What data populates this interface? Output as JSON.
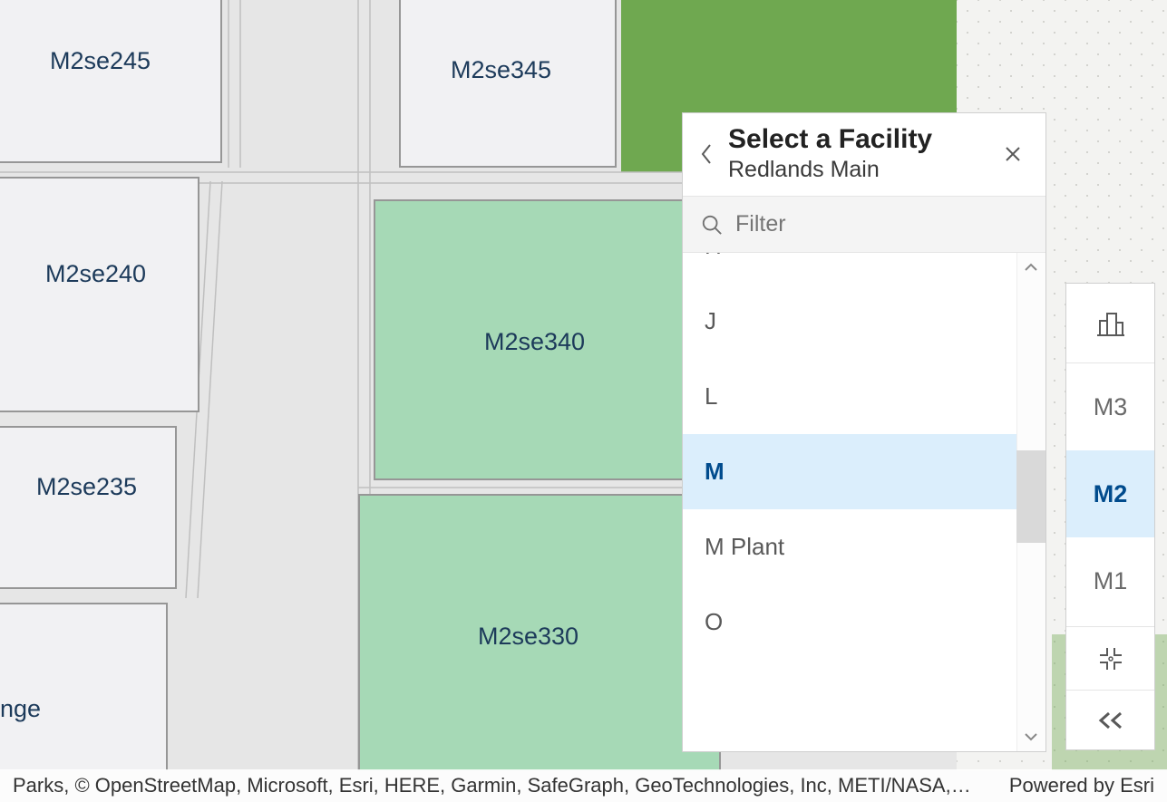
{
  "rooms": {
    "r245": "M2se245",
    "r240": "M2se240",
    "r235": "M2se235",
    "rlounge": "nge",
    "r345": "M2se345",
    "r340": "M2se340",
    "r330": "M2se330"
  },
  "panel": {
    "title": "Select a Facility",
    "subtitle": "Redlands Main",
    "filter_placeholder": "Filter",
    "items": [
      {
        "label": "H",
        "partial": true
      },
      {
        "label": "J"
      },
      {
        "label": "L"
      },
      {
        "label": "M",
        "selected": true
      },
      {
        "label": "M Plant"
      },
      {
        "label": "O",
        "partial_bottom": true
      }
    ]
  },
  "floors": {
    "levels": [
      "M3",
      "M2",
      "M1"
    ],
    "selected": "M2"
  },
  "attribution": {
    "left": "Parks, © OpenStreetMap, Microsoft, Esri, HERE, Garmin, SafeGraph, GeoTechnologies, Inc, METI/NASA,…",
    "right": "Powered by Esri"
  }
}
